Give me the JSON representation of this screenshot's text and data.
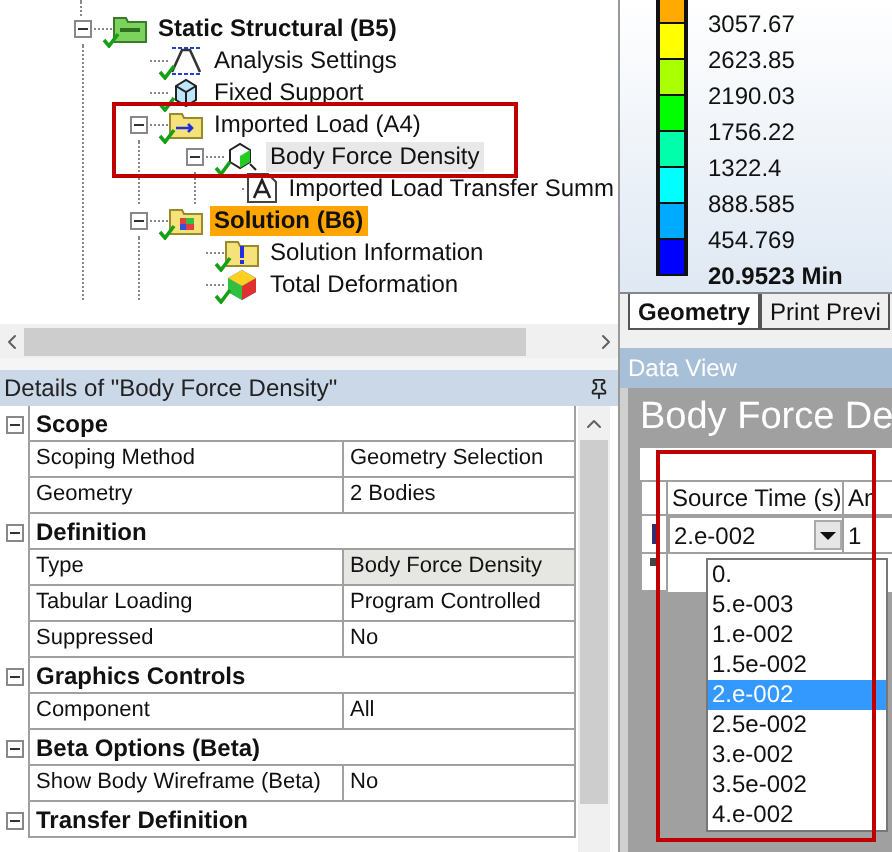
{
  "tree": {
    "items": [
      {
        "label": "Static Structural (B5)",
        "checked": true,
        "bold": true,
        "selected": false,
        "active": false,
        "expanded": true,
        "children": [
          {
            "label": "Analysis Settings",
            "checked": true,
            "selected": false,
            "active": false
          },
          {
            "label": "Fixed Support",
            "checked": true,
            "selected": false,
            "active": false
          },
          {
            "label": "Imported Load (A4)",
            "checked": true,
            "selected": false,
            "active": false,
            "expanded": true,
            "children": [
              {
                "label": "Body Force Density",
                "checked": true,
                "selected": true,
                "active": false,
                "expanded": true,
                "children": [
                  {
                    "label": "Imported Load Transfer Summ",
                    "checked": false,
                    "selected": false,
                    "active": false
                  }
                ]
              }
            ]
          },
          {
            "label": "Solution (B6)",
            "checked": true,
            "bold": true,
            "selected": false,
            "active": true,
            "expanded": true,
            "children": [
              {
                "label": "Solution Information",
                "checked": true,
                "selected": false,
                "active": false
              },
              {
                "label": "Total Deformation",
                "checked": true,
                "selected": false,
                "active": false
              }
            ]
          }
        ]
      }
    ]
  },
  "details": {
    "title": "Details of \"Body Force Density\"",
    "sections": [
      {
        "title": "Scope",
        "expanded": true,
        "rows": [
          {
            "name": "Scoping Method",
            "value": "Geometry Selection",
            "readonly": false
          },
          {
            "name": "Geometry",
            "value": "2 Bodies",
            "readonly": false
          }
        ]
      },
      {
        "title": "Definition",
        "expanded": true,
        "rows": [
          {
            "name": "Type",
            "value": "Body Force Density",
            "readonly": true
          },
          {
            "name": "Tabular Loading",
            "value": "Program Controlled",
            "readonly": false
          },
          {
            "name": "Suppressed",
            "value": "No",
            "readonly": false
          }
        ]
      },
      {
        "title": "Graphics Controls",
        "expanded": true,
        "rows": [
          {
            "name": "Component",
            "value": "All",
            "readonly": false
          }
        ]
      },
      {
        "title": "Beta Options (Beta)",
        "expanded": true,
        "rows": [
          {
            "name": "Show Body Wireframe (Beta)",
            "value": "No",
            "readonly": false
          }
        ]
      },
      {
        "title": "Transfer Definition",
        "expanded": true
      }
    ]
  },
  "legend": {
    "items": [
      {
        "label": "3057.67",
        "color": "#ffaa00",
        "bold": false
      },
      {
        "label": "2623.85",
        "color": "#ffff00",
        "bold": false
      },
      {
        "label": "2190.03",
        "color": "#aaff00",
        "bold": false
      },
      {
        "label": "1756.22",
        "color": "#00ff00",
        "bold": false
      },
      {
        "label": "1322.4",
        "color": "#00ffaa",
        "bold": false
      },
      {
        "label": "888.585",
        "color": "#00ffff",
        "bold": false
      },
      {
        "label": "454.769",
        "color": "#00aaff",
        "bold": false
      },
      {
        "label": "20.9523 Min",
        "color": "#0000ff",
        "bold": true
      }
    ]
  },
  "tabs": [
    {
      "label": "Geometry",
      "selected": true
    },
    {
      "label": "Print Previ",
      "selected": false
    }
  ],
  "data_view": {
    "title": "Data View",
    "heading": "Body Force De",
    "columns": [
      "Source Time (s)",
      "An"
    ],
    "rows": [
      {
        "kind": "current",
        "source_time": "2.e-002",
        "column_2": "1"
      },
      {
        "kind": "new"
      }
    ],
    "options": [
      {
        "label": "0.",
        "selected": false
      },
      {
        "label": "5.e-003",
        "selected": false
      },
      {
        "label": "1.e-002",
        "selected": false
      },
      {
        "label": "1.5e-002",
        "selected": false
      },
      {
        "label": "2.e-002",
        "selected": true
      },
      {
        "label": "2.5e-002",
        "selected": false
      },
      {
        "label": "3.e-002",
        "selected": false
      },
      {
        "label": "3.5e-002",
        "selected": false
      },
      {
        "label": "4.e-002",
        "selected": false
      }
    ]
  }
}
